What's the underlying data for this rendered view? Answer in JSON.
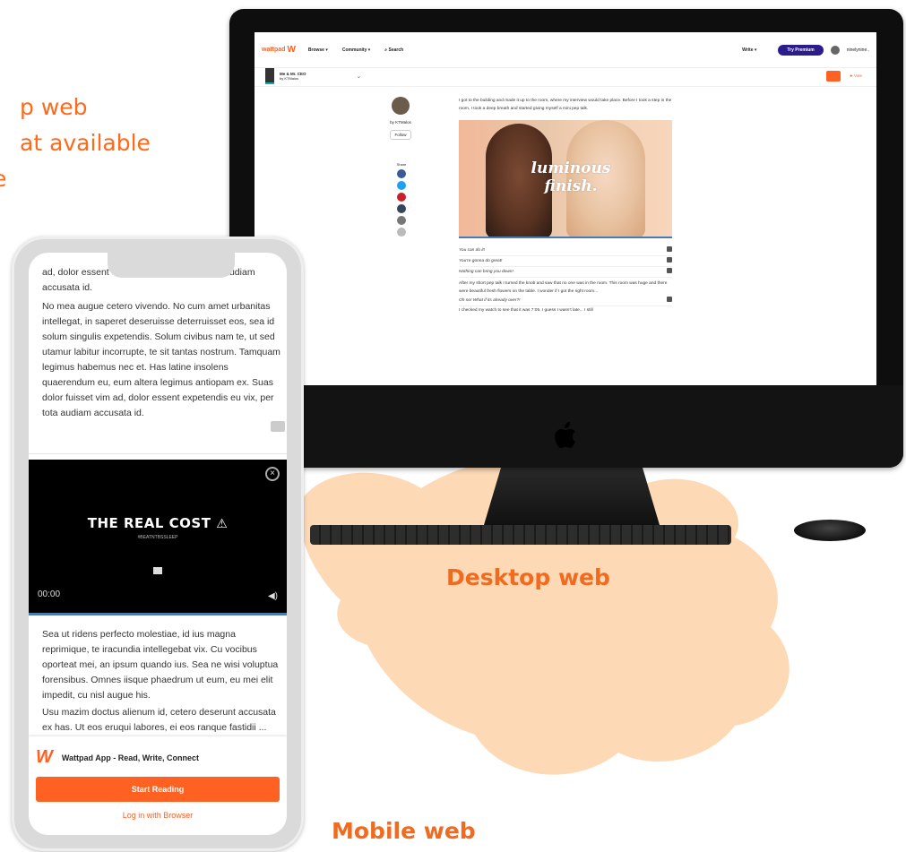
{
  "intro": {
    "line1": "p web",
    "line2": "at available",
    "line3": "e"
  },
  "captions": {
    "desktop": "Desktop web",
    "mobile": "Mobile web"
  },
  "colors": {
    "accent": "#ff6122",
    "premium": "#2a1c8a",
    "blob": "#fdd9b5"
  },
  "desktop": {
    "nav": {
      "logo": "wattpad",
      "browse": "Browse ▾",
      "community": "Community ▾",
      "search": "Search",
      "write": "Write ▾",
      "premium": "Try Premium",
      "user": "ninelynine.."
    },
    "story": {
      "title": "Me & Mr. CEO",
      "author": "by KTMalos",
      "vote": "Vote"
    },
    "author_block": {
      "by": "by KTMalos",
      "follow": "Follow",
      "share": "Share"
    },
    "paragraph1": "I got to the building and made it up to the room, where my interview would take place. Before I took a step in the room, I took a deep breath and started giving myself a mini pep talk.",
    "ad_text": "luminous finish.",
    "quotes": [
      "You can do it!",
      "You're gonna do great!",
      "Nothing can bring you down!"
    ],
    "paragraph2": "After my short pep talk I turned the knob and saw that no one was in the room. This room was huge and there were beautiful fresh flowers on the table. I wonder if I got the right room...",
    "quote4": "Oh no! What if its already over?!",
    "paragraph3": "I checked my watch to see that it was 7:05. I guess I wasn't late... I still"
  },
  "mobile": {
    "top_text": "ad, dolor essent expetendis eu vix, per tota audiam accusata id.",
    "para1": "No mea augue cetero vivendo. No cum amet urbanitas intellegat, in saperet deseruisse deterruisset eos, sea id solum singulis expetendis. Solum civibus nam te, ut sed utamur labitur incorrupte, te sit tantas nostrum. Tamquam legimus habemus nec et. Has latine insolens quaerendum eu, eum altera legimus antiopam ex. Suas dolor fuisset vim ad, dolor essent expetendis eu vix, per tota audiam accusata id.",
    "video": {
      "title": "THE REAL COST",
      "subtitle": "#BEATNTBSSLEEP",
      "time": "00:00"
    },
    "para2": "Sea ut ridens perfecto molestiae, id ius magna reprimique, te iracundia intellegebat vix. Cu vocibus oporteat mei, an ipsum quando ius. Sea ne wisi voluptua forensibus. Omnes iisque phaedrum ut eum, eu mei elit impedit, cu nisl augue his.",
    "para3": "Usu mazim doctus alienum id, cetero deserunt accusata ex has. Ut eos eruqui labores, ei eos ranque fastidii ...",
    "banner": {
      "app": "Wattpad App - Read, Write, Connect",
      "start": "Start Reading",
      "login": "Log in with Browser"
    }
  }
}
